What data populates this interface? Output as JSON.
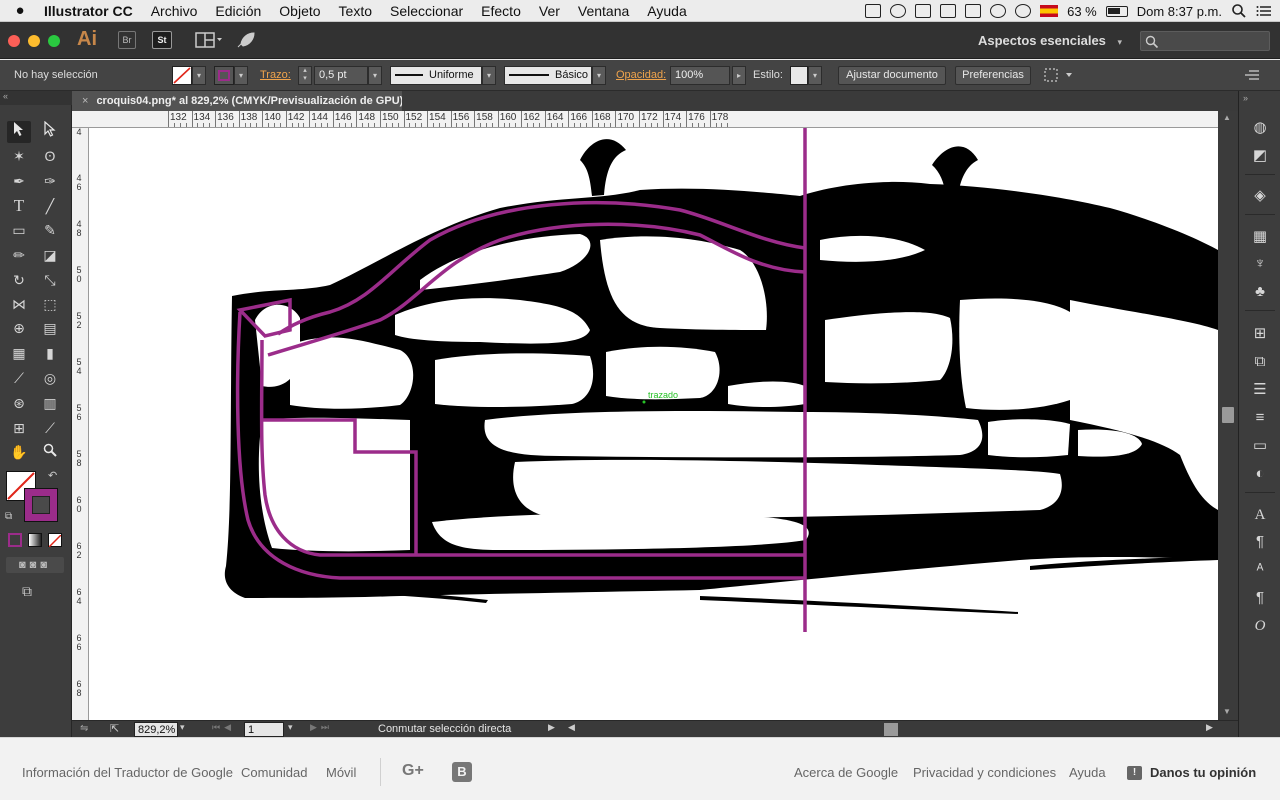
{
  "menubar": {
    "app_name": "Illustrator CC",
    "items": [
      "Archivo",
      "Edición",
      "Objeto",
      "Texto",
      "Seleccionar",
      "Efecto",
      "Ver",
      "Ventana",
      "Ayuda"
    ],
    "battery": "63 %",
    "clock": "Dom 8:37 p.m.",
    "flag_label": "ISO"
  },
  "titlebar": {
    "logo": "Ai",
    "bridge_label": "Br",
    "stock_label": "St",
    "workspace": "Aspectos esenciales"
  },
  "controlbar": {
    "selection_status": "No hay selección",
    "stroke_label": "Trazo:",
    "stroke_value": "0,5 pt",
    "profile": "Uniforme",
    "brush": "Básico",
    "opacity_label": "Opacidad:",
    "opacity_value": "100%",
    "style_label": "Estilo:",
    "fit_document_button": "Ajustar documento",
    "preferences_button": "Preferencias"
  },
  "document": {
    "tab_title": "croquis04.png* al 829,2% (CMYK/Previsualización de GPU)",
    "close_glyph": "×"
  },
  "ruler": {
    "top_labels": [
      "132",
      "134",
      "136",
      "138",
      "140",
      "142",
      "144",
      "146",
      "148",
      "150",
      "152",
      "154",
      "156",
      "158",
      "160",
      "162",
      "164",
      "166",
      "168",
      "170",
      "172",
      "174",
      "176",
      "178"
    ],
    "left_labels": [
      "4",
      "4 6",
      "4 8",
      "5 0",
      "5 2",
      "5 4",
      "5 6",
      "5 8",
      "6 0",
      "6 2",
      "6 4",
      "6 6",
      "6 8"
    ]
  },
  "canvas": {
    "smart_guide_label": "trazado"
  },
  "statusbar": {
    "zoom": "829,2%",
    "artboard": "1",
    "status_text": "Conmutar selección directa"
  },
  "footer": {
    "left_links": [
      "Información del Traductor de Google",
      "Comunidad",
      "Móvil"
    ],
    "gplus": "G+",
    "blogger": "B",
    "right_links": [
      "Acerca de Google",
      "Privacidad y condiciones",
      "Ayuda"
    ],
    "feedback": "Danos tu opinión"
  },
  "colors": {
    "accent_path": "#9b2c8a",
    "ink": "#000000",
    "smart_guide": "#27c227",
    "ui_orange": "#f0a44c"
  }
}
